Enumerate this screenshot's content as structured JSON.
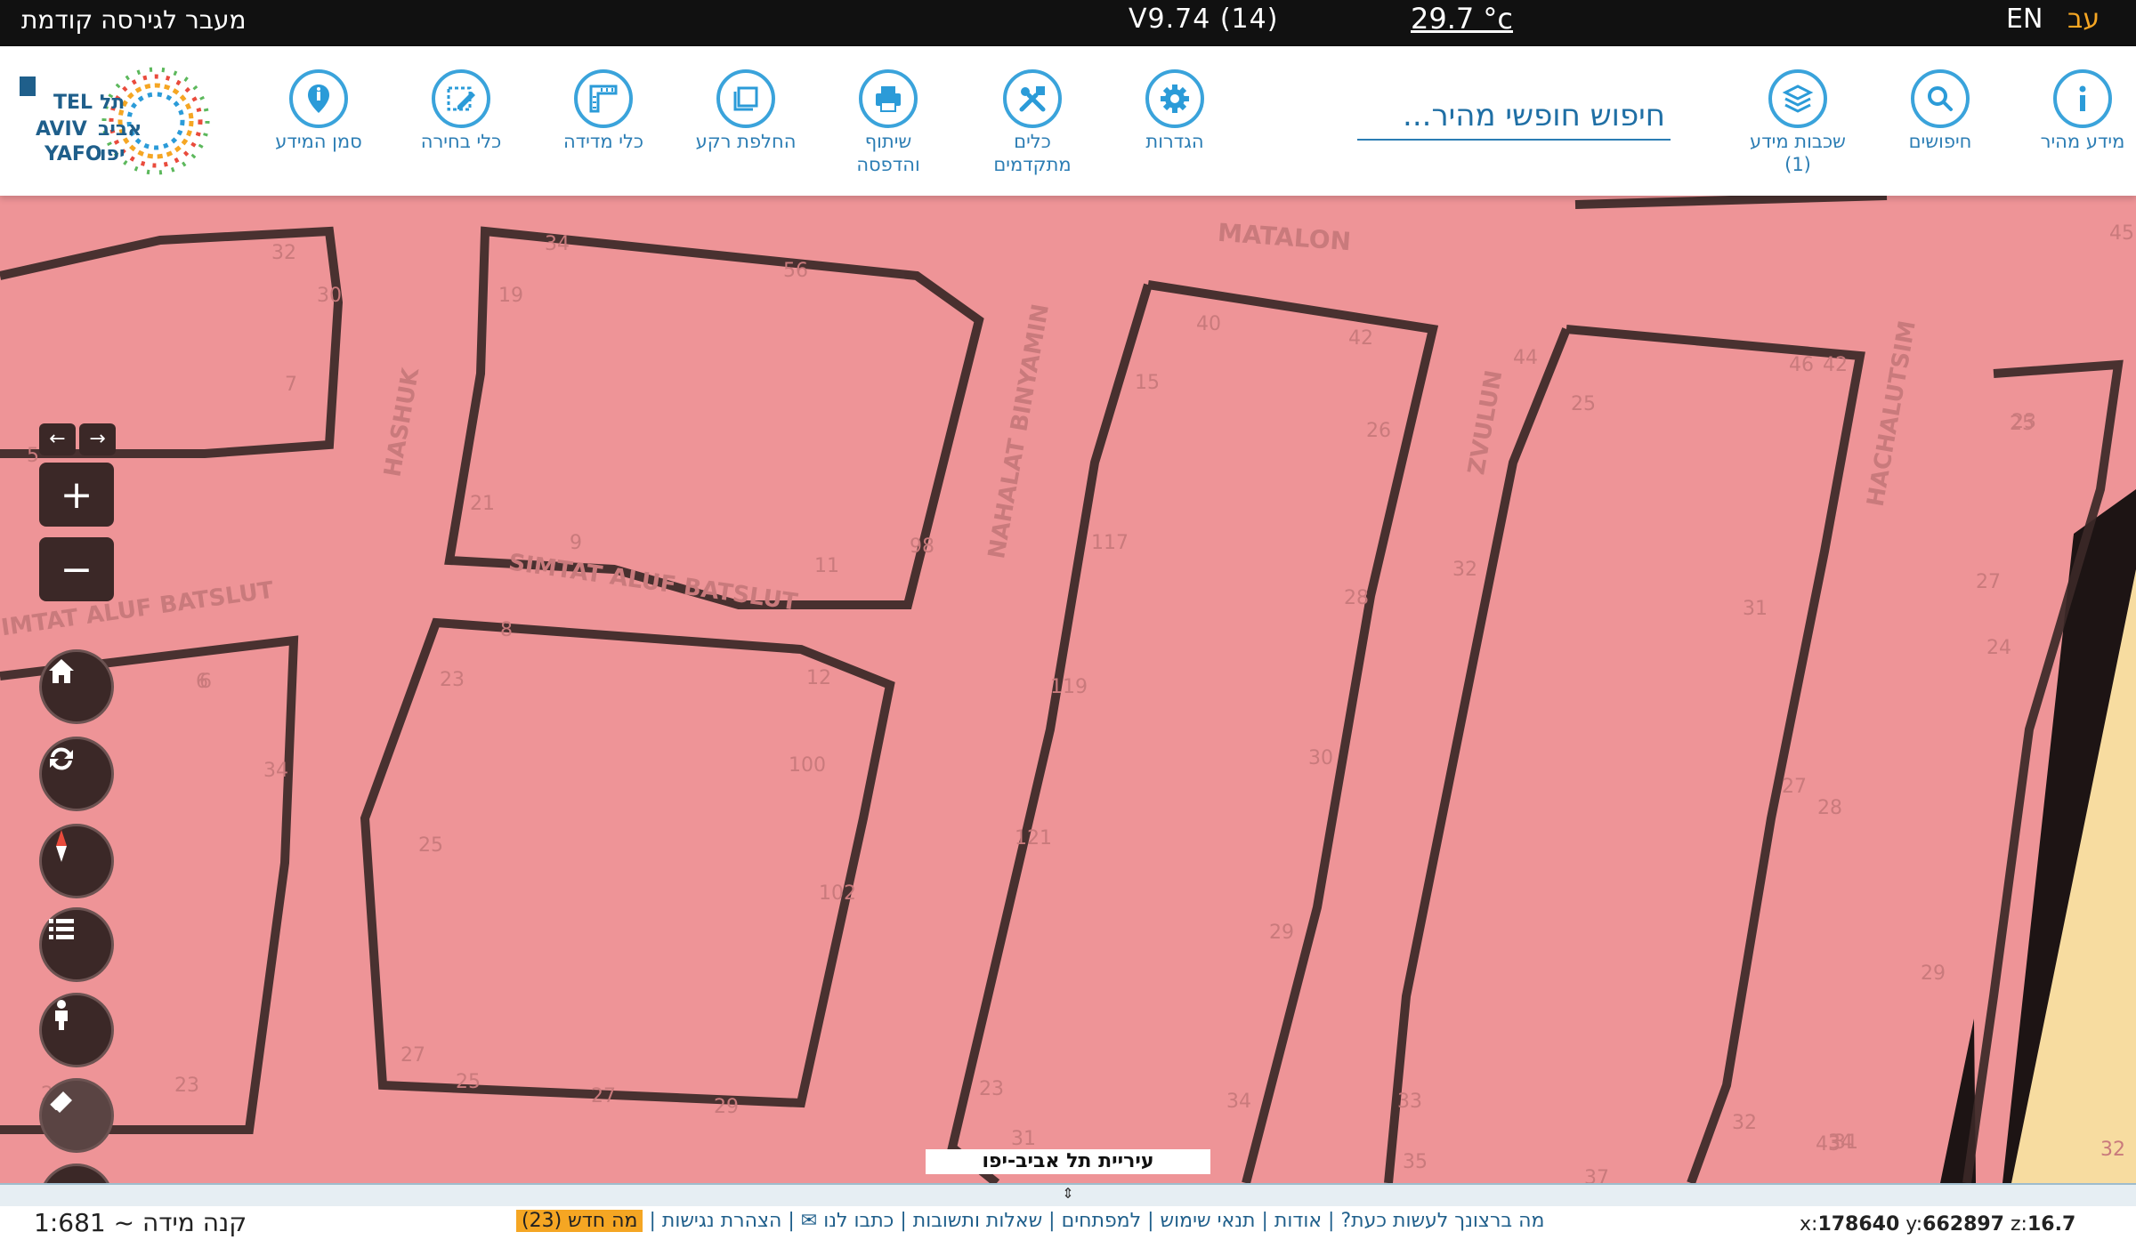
{
  "topbar": {
    "prev_version": "מעבר לגירסה קודמת",
    "version": "V9.74 (14)",
    "temperature": "29.7 °c",
    "lang_en": "EN",
    "lang_he": "עב"
  },
  "toolbar": {
    "marker": "סמן המידע",
    "select": "כלי בחירה",
    "measure": "כלי מדידה",
    "basemap": "החלפת רקע",
    "share_1": "שיתוף",
    "share_2": "והדפסה",
    "advanced_1": "כלים",
    "advanced_2": "מתקדמים",
    "settings": "הגדרות",
    "search_placeholder": "חיפוש חופשי מהיר...",
    "layers_1": "שכבות מידע",
    "layers_2": "(1)",
    "searches": "חיפושים",
    "quick_info": "מידע מהיר"
  },
  "logo": {
    "line1": "תל",
    "line2": "אביב",
    "line3": "יפו",
    "en1": "TEL",
    "en2": "AVIV",
    "en3": "YAFO"
  },
  "map": {
    "streets": {
      "matalon": "MATALON",
      "hashuk": "HASHUK",
      "nahalat": "NAHALAT BINYAMIN",
      "zvulun": "ZVULUN",
      "hachalutsim": "HACHALUTSIM",
      "simtat1": "SIMTAT ALUF BATSLUT",
      "simtat2": "IMTAT ALUF BATSLUT"
    },
    "house_numbers": [
      "32",
      "30",
      "7",
      "5",
      "34",
      "19",
      "56",
      "21",
      "9",
      "11",
      "98",
      "40",
      "42",
      "15",
      "26",
      "44",
      "46",
      "25",
      "28",
      "117",
      "119",
      "121",
      "8",
      "23",
      "12",
      "100",
      "6",
      "34",
      "25",
      "27",
      "102",
      "30",
      "29",
      "32",
      "31",
      "27",
      "28",
      "24",
      "25",
      "27",
      "29",
      "45",
      "23",
      "42",
      "6",
      "21",
      "23",
      "25",
      "27",
      "29",
      "23",
      "31",
      "34",
      "35",
      "37",
      "33",
      "32",
      "31",
      "34",
      "43",
      "32"
    ],
    "controls": {
      "zoom_in": "+",
      "zoom_out": "−",
      "three_d": "3D",
      "arrow_left": "←",
      "arrow_right": "→"
    },
    "city_label": "עיריית תל אביב-יפו",
    "handle": "⇕"
  },
  "status": {
    "scale": "1:681 ~ קנה מידה",
    "links": [
      "מה ברצונך לעשות כעת?",
      "אודות",
      "תנאי שימוש",
      "למפתחים",
      "שאלות ותשובות",
      "כתבו לנו ✉",
      "הצהרת נגישות"
    ],
    "whats_new": "מה חדש (23)",
    "x_label": "x:",
    "x_val": "178640",
    "y_label": "y:",
    "y_val": "662897",
    "z_label": "z:",
    "z_val": "16.7"
  },
  "colors": {
    "parcel_fill": "#ee9497",
    "parcel_border": "#3b2827",
    "accent_blue": "#3aa3db",
    "orange": "#f5a623",
    "sand": "#f7dca0"
  }
}
